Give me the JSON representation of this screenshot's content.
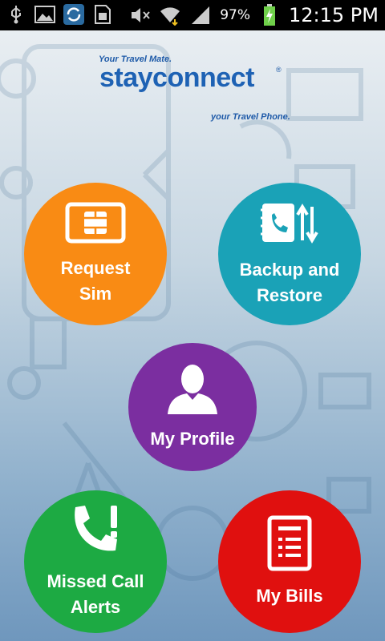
{
  "status_bar": {
    "battery_percent": "97%",
    "time": "12:15 PM",
    "icons": [
      "usb-icon",
      "gallery-icon",
      "sync-icon",
      "sim-icon",
      "mute-icon",
      "wifi-icon",
      "signal-icon",
      "battery-charging-icon"
    ]
  },
  "logo": {
    "tagline_top": "Your Travel Mate.",
    "brand": "stayconnect",
    "tagline_bottom": "your Travel Phone."
  },
  "buttons": {
    "request_sim": {
      "line1": "Request",
      "line2": "Sim",
      "color": "#f98b14"
    },
    "backup_restore": {
      "line1": "Backup and",
      "line2": "Restore",
      "color": "#1aa2b7"
    },
    "my_profile": {
      "label": "My Profile",
      "color": "#7b2ea0"
    },
    "missed_call": {
      "line1": "Missed Call",
      "line2": "Alerts",
      "color": "#1daa43"
    },
    "my_bills": {
      "label": "My Bills",
      "color": "#e0100f"
    }
  }
}
